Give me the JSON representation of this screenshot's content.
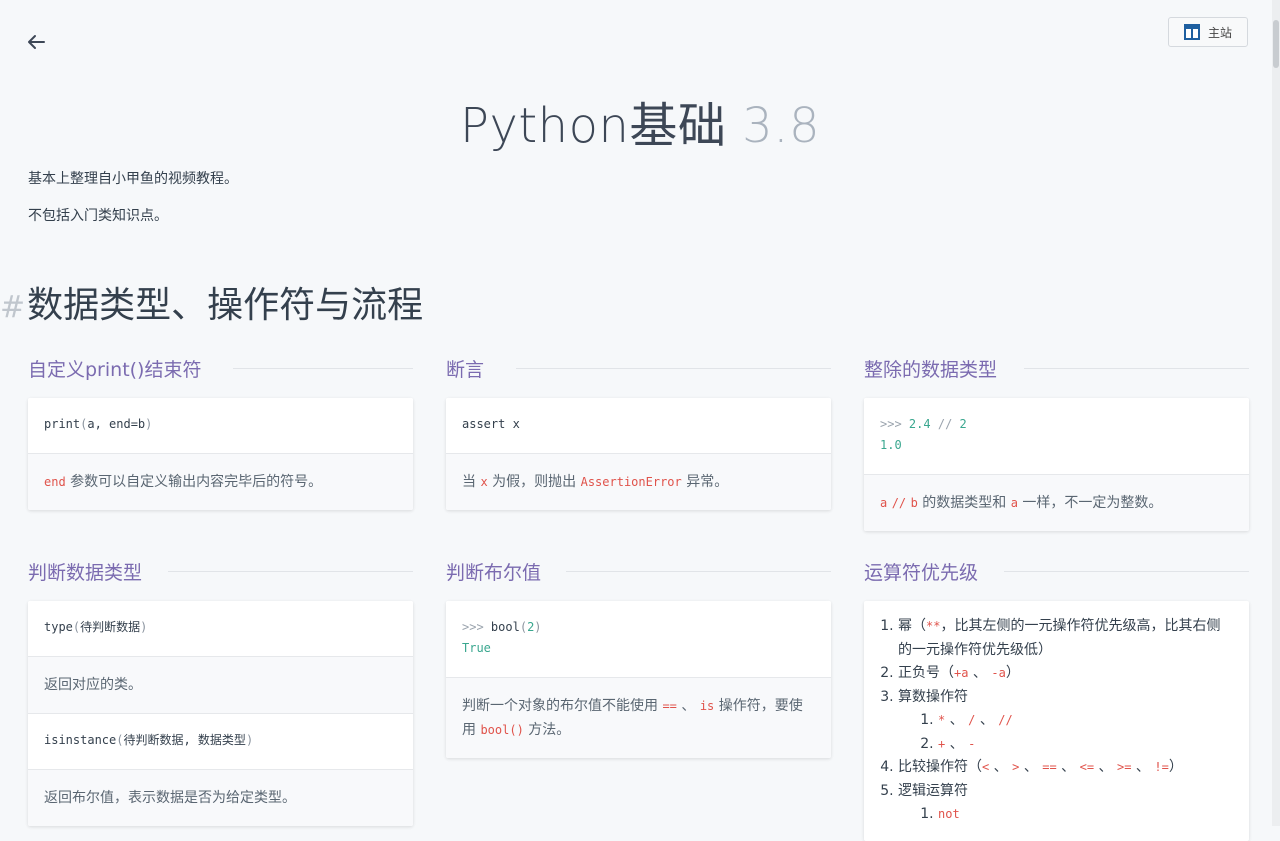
{
  "header": {
    "home_label": "主站"
  },
  "page": {
    "title_main": "Python基础",
    "title_version": "3.8",
    "intro1": "基本上整理自小甲鱼的视频教程。",
    "intro2": "不包括入门类知识点。"
  },
  "section": {
    "hash": "#",
    "title": "数据类型、操作符与流程"
  },
  "cards": {
    "print_end": {
      "title": "自定义print()结束符",
      "code_fn": "print",
      "code_args": "a, end=b",
      "desc_kw": "end",
      "desc_text": " 参数可以自定义输出内容完毕后的符号。"
    },
    "assert": {
      "title": "断言",
      "code": "assert x",
      "desc_pre": "当 ",
      "desc_kw1": "x",
      "desc_mid": " 为假，则抛出 ",
      "desc_kw2": "AssertionError",
      "desc_post": " 异常。"
    },
    "floor_div": {
      "title": "整除的数据类型",
      "code_prompt": ">>>",
      "code_expr_a": "2.4",
      "code_op": "//",
      "code_expr_b": "2",
      "code_result": "1.0",
      "desc_kw1": "a",
      "desc_op": "//",
      "desc_kw2": "b",
      "desc_mid": " 的数据类型和 ",
      "desc_kw3": "a",
      "desc_post": " 一样，不一定为整数。"
    },
    "type_check": {
      "title": "判断数据类型",
      "code1_fn": "type",
      "code1_args": "待判断数据",
      "desc1": "返回对应的类。",
      "code2_fn": "isinstance",
      "code2_args": "待判断数据, 数据类型",
      "desc2": "返回布尔值，表示数据是否为给定类型。"
    },
    "bool": {
      "title": "判断布尔值",
      "code_prompt": ">>>",
      "code_fn": "bool",
      "code_arg": "2",
      "code_result": "True",
      "desc_pre": "判断一个对象的布尔值不能使用 ",
      "desc_kw1": "==",
      "desc_sep": " 、 ",
      "desc_kw2": "is",
      "desc_mid": " 操作符，要使用 ",
      "desc_kw3": "bool()",
      "desc_post": " 方法。"
    },
    "precedence": {
      "title": "运算符优先级",
      "item1_pre": "幂（",
      "item1_code": "**",
      "item1_post": "，比其左侧的一元操作符优先级高，比其右侧的一元操作符优先级低）",
      "item2_pre": "正负号（",
      "item2_code1": "+a",
      "item2_sep": " 、 ",
      "item2_code2": "-a",
      "item2_post": "）",
      "item3": "算数操作符",
      "item3_sub1_c1": "*",
      "item3_sub1_c2": "/",
      "item3_sub1_c3": "//",
      "sep": " 、 ",
      "item3_sub2_c1": "+",
      "item3_sub2_c2": "-",
      "item4_pre": "比较操作符（",
      "item4_c1": "<",
      "item4_c2": ">",
      "item4_c3": "==",
      "item4_c4": "<=",
      "item4_c5": ">=",
      "item4_c6": "!=",
      "item4_post": "）",
      "item5": "逻辑运算符",
      "item5_sub1": "not"
    }
  },
  "colors": {
    "accent": "#7b6bb0",
    "code_keyword": "#e0534b",
    "code_number": "#3aa78f"
  }
}
